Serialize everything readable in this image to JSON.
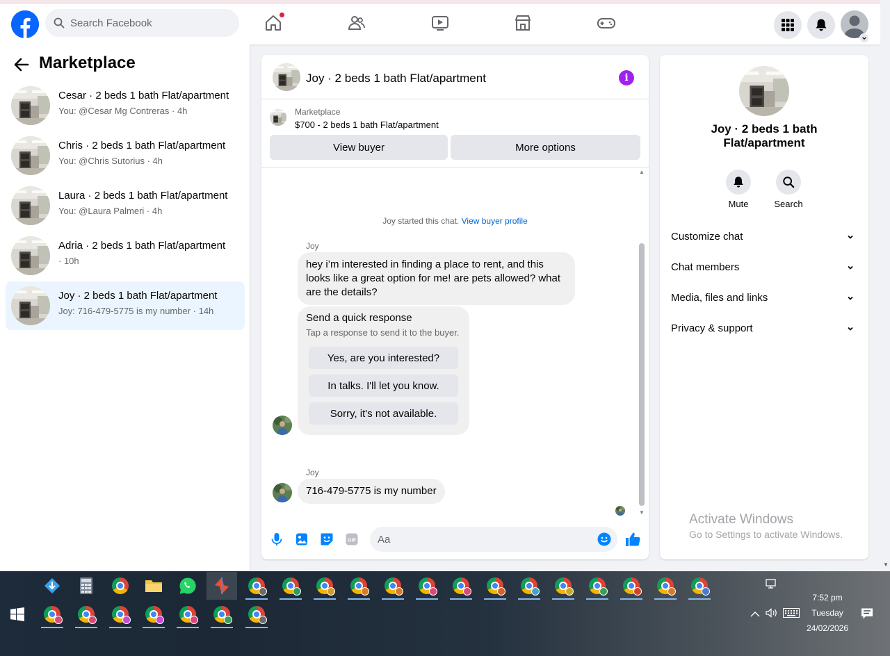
{
  "topbar": {
    "search_placeholder": "Search Facebook"
  },
  "sidebar": {
    "title": "Marketplace",
    "conversations": [
      {
        "title": "Cesar · 2 beds 1 bath Flat/apartment",
        "subtitle": "You: @Cesar Mg Contreras · 4h",
        "active": false
      },
      {
        "title": "Chris · 2 beds 1 bath Flat/apartment",
        "subtitle": "You: @Chris Sutorius · 4h",
        "active": false
      },
      {
        "title": "Laura · 2 beds 1 bath Flat/apartment",
        "subtitle": "You: @Laura Palmeri · 4h",
        "active": false
      },
      {
        "title": "Adria · 2 beds 1 bath Flat/apartment",
        "subtitle": " · 10h",
        "active": false
      },
      {
        "title": "Joy · 2 beds 1 bath Flat/apartment",
        "subtitle": "Joy: 716-479-5775 is my number · 14h",
        "active": true
      }
    ]
  },
  "chat": {
    "header_title": "Joy · 2 beds 1 bath Flat/apartment",
    "listing": {
      "label": "Marketplace",
      "price_title": "$700 - 2 beds 1 bath Flat/apartment",
      "view_buyer": "View buyer",
      "more_options": "More options"
    },
    "system_text": "Joy started this chat.",
    "system_link": "View buyer profile",
    "messages": [
      {
        "sender": "Joy",
        "text": "hey i’m interested in finding a place to rent, and this looks like a great option for me! are pets allowed? what are the details?"
      },
      {
        "sender": "Joy",
        "text": "716-479-5775 is my number"
      }
    ],
    "quick_response": {
      "title": "Send a quick response",
      "subtitle": "Tap a response to send it to the buyer.",
      "options": [
        "Yes, are you interested?",
        "In talks. I'll let you know.",
        "Sorry, it's not available."
      ]
    },
    "composer_placeholder": "Aa"
  },
  "right_panel": {
    "title": "Joy · 2 beds 1 bath Flat/apartment",
    "actions": [
      {
        "label": "Mute",
        "icon": "bell-icon"
      },
      {
        "label": "Search",
        "icon": "search-icon"
      }
    ],
    "sections": [
      "Customize chat",
      "Chat members",
      "Media, files and links",
      "Privacy & support"
    ]
  },
  "watermark": {
    "line1": "Activate Windows",
    "line2": "Go to Settings to activate Windows."
  },
  "taskbar": {
    "time": "7:52 pm",
    "day": "Tuesday",
    "date": "24/02/2026"
  },
  "colors": {
    "brand_blue": "#0866ff",
    "active_conv_bg": "#ebf5ff",
    "messenger_blue": "#0084ff",
    "info_purple": "#a020f0"
  }
}
